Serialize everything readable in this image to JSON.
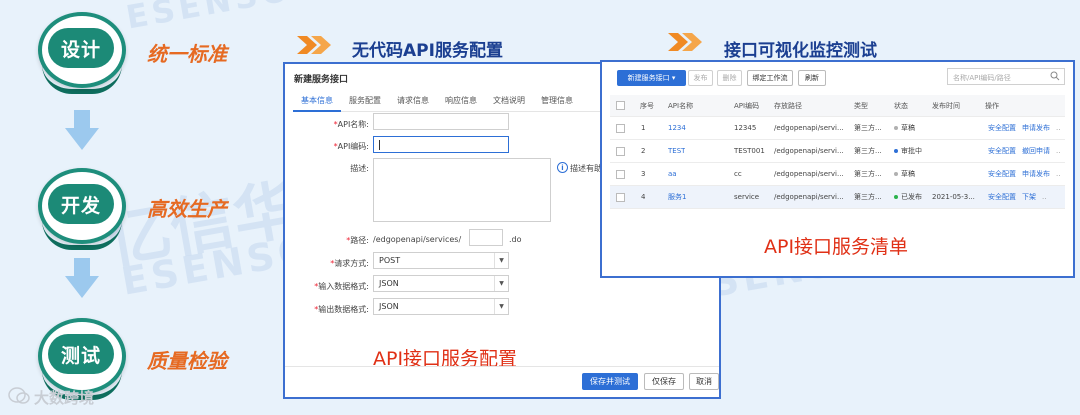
{
  "watermark": {
    "cn": "亿信华辰",
    "en": "ESENSOFT",
    "top_en": "ESENSOF"
  },
  "steps": [
    {
      "pill": "设计",
      "label": "统一标准"
    },
    {
      "pill": "开发",
      "label": "高效生产"
    },
    {
      "pill": "测试",
      "label": "质量检验"
    }
  ],
  "footer_logo": "大数跨境",
  "section1_title": "无代码API服务配置",
  "section2_title": "接口可视化监控测试",
  "form": {
    "title": "新建服务接口",
    "tabs": [
      "基本信息",
      "服务配置",
      "请求信息",
      "响应信息",
      "文档说明",
      "管理信息"
    ],
    "api_name_label": "API名称:",
    "api_code_label": "API编码:",
    "desc_label": "描述:",
    "desc_hint": "描述有助",
    "path_label": "路径:",
    "path_prefix": "/edgopenapi/services/",
    "path_suffix": ".do",
    "method_label": "请求方式:",
    "method_value": "POST",
    "input_format_label": "输入数据格式:",
    "input_format_value": "JSON",
    "output_format_label": "输出数据格式:",
    "output_format_value": "JSON",
    "btn_save_test": "保存并测试",
    "btn_save": "仅保存",
    "btn_cancel": "取消",
    "caption": "API接口服务配置"
  },
  "list": {
    "btn_new": "新建服务接口",
    "btn_publish": "发布",
    "btn_delete": "删除",
    "btn_bind": "绑定工作流",
    "btn_refresh": "刷新",
    "search_placeholder": "名称/API编码/路径",
    "headers": {
      "seq": "序号",
      "name": "API名称",
      "code": "API编码",
      "path": "存放路径",
      "type": "类型",
      "status": "状态",
      "publish_time": "发布时间",
      "ops": "操作"
    },
    "rows": [
      {
        "seq": "1",
        "name": "1234",
        "code": "12345",
        "path": "/edgopenapi/servi...",
        "type": "第三方...",
        "status": "草稿",
        "status_color": "#b0b0b0",
        "time": "",
        "op1": "安全配置",
        "op2": "申请发布"
      },
      {
        "seq": "2",
        "name": "TEST",
        "code": "TEST001",
        "path": "/edgopenapi/servi...",
        "type": "第三方...",
        "status": "审批中",
        "status_color": "#2d6fd6",
        "time": "",
        "op1": "安全配置",
        "op2": "撤回申请"
      },
      {
        "seq": "3",
        "name": "aa",
        "code": "cc",
        "path": "/edgopenapi/servi...",
        "type": "第三方...",
        "status": "草稿",
        "status_color": "#b0b0b0",
        "time": "",
        "op1": "安全配置",
        "op2": "申请发布"
      },
      {
        "seq": "4",
        "name": "服务1",
        "code": "service",
        "path": "/edgopenapi/servi...",
        "type": "第三方...",
        "status": "已发布",
        "status_color": "#2bb24c",
        "time": "2021-05-3...",
        "op1": "安全配置",
        "op2": "下架"
      }
    ],
    "caption": "API接口服务清单"
  },
  "colors": {
    "accent": "#2d6fd6",
    "teal": "#1c8a77",
    "orange": "#e66a22",
    "title_blue": "#1b3f91",
    "caption_red": "#e03016"
  }
}
